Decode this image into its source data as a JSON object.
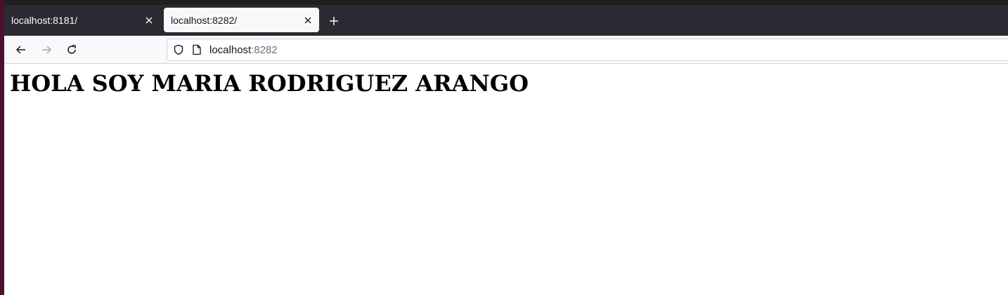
{
  "tabs": [
    {
      "title": "localhost:8181/",
      "active": false
    },
    {
      "title": "localhost:8282/",
      "active": true
    }
  ],
  "toolbar": {
    "new_tab_icon": "plus-icon",
    "back_icon": "arrow-left-icon",
    "forward_icon": "arrow-right-icon",
    "reload_icon": "reload-icon"
  },
  "urlbar": {
    "host": "localhost",
    "port": ":8282",
    "shield_icon": "shield-icon",
    "page_icon": "page-icon"
  },
  "page": {
    "heading": "HOLA SOY MARIA RODRIGUEZ ARANGO"
  },
  "colors": {
    "tabbar_bg": "#2b2a33",
    "active_tab_bg": "#f9f9fb",
    "toolbar_bg": "#f9f9fb"
  }
}
